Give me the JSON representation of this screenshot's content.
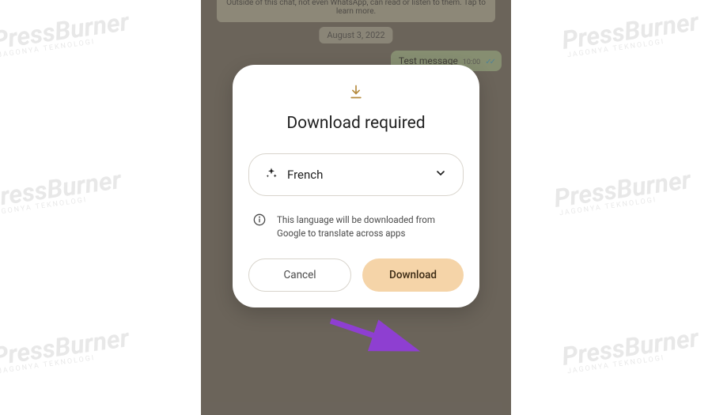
{
  "watermark": {
    "brand": "PressBurner",
    "tagline": "JAGONYA TEKNOLOGI"
  },
  "chat": {
    "encryption_text": "Outside of this chat, not even WhatsApp, can read or listen to them. Tap to learn more.",
    "date": "August 3, 2022",
    "message": {
      "text": "Test message",
      "time": "10:00"
    }
  },
  "dialog": {
    "title": "Download required",
    "language": "French",
    "info": "This language will be downloaded from Google to translate across apps",
    "cancel_label": "Cancel",
    "download_label": "Download"
  }
}
